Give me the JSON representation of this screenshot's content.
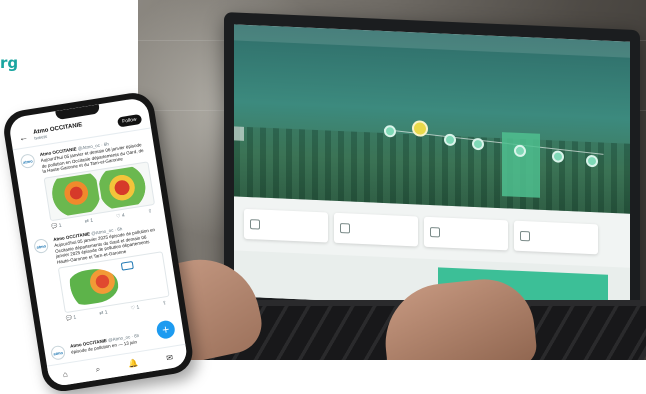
{
  "brand": {
    "text": "rg"
  },
  "laptop": {
    "nav_items": [
      "",
      "",
      ""
    ],
    "tiles": [
      "",
      "",
      "",
      ""
    ],
    "bottom_title": ""
  },
  "phone": {
    "header": {
      "name": "Atmo OCCITANIE",
      "sub": "tweets",
      "follow": "Follow"
    },
    "tweets": [
      {
        "handle": "Atmo OCCITANIE",
        "meta": "@Atmo_oc · 6h",
        "text": "Aujourd'hui 05 janvier et demain 06 janvier épisode de pollution en Occitanie départements du Gard, de la Haute-Garonne et du Tarn-et-Garonne",
        "tags": [
          "#pollution",
          "#Occitanie"
        ],
        "actions": [
          "1",
          "1",
          "4",
          "1"
        ]
      },
      {
        "handle": "Atmo OCCITANIE",
        "meta": "@Atmo_oc · 6h",
        "text": "Aujourd'hui 05 janvier 2025 épisode de pollution en Occitanie départements du Gard et demain 06 janvier 2025 épisode de pollution départements Haute-Garonne et Tarn-et-Garonne",
        "tags": [
          "#pollution",
          "#Occitanie"
        ],
        "actions": [
          "1",
          "1",
          "1",
          "1"
        ]
      },
      {
        "handle": "Atmo OCCITANIE",
        "meta": "@Atmo_oc · 6h",
        "text": "épisode de pollution en — 13 juin",
        "tags": [],
        "actions": []
      }
    ],
    "fab": "+",
    "tabs": [
      "⌂",
      "⌕",
      "🔔",
      "✉"
    ]
  },
  "colors": {
    "brand": "#1aa5a0",
    "hero_top": "#2f6e6a",
    "highlight": "#4fbf8f",
    "twitter_blue": "#1d9bf0"
  }
}
